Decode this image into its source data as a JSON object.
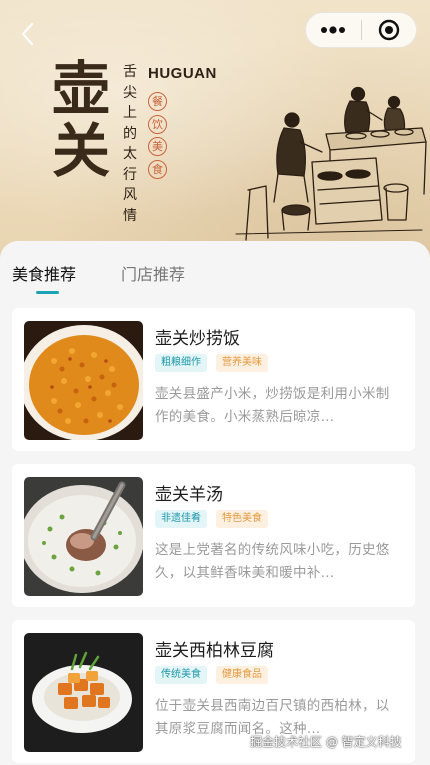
{
  "header": {
    "brand_chars": [
      "壶",
      "关"
    ],
    "brand_en": "HUGUAN",
    "slogan_chars": [
      "舌",
      "尖",
      "上",
      "的",
      "太",
      "行",
      "风",
      "情"
    ],
    "seal_chars": [
      "餐",
      "饮",
      "美",
      "食"
    ]
  },
  "nav": {
    "back_icon": "chevron-left-icon",
    "more_icon": "more-dots-icon",
    "close_icon": "target-circle-icon"
  },
  "tabs": [
    {
      "label": "美食推荐",
      "active": true
    },
    {
      "label": "门店推荐",
      "active": false
    }
  ],
  "foods": [
    {
      "title": "壶关炒捞饭",
      "tags": [
        "粗粮细作",
        "营养美味"
      ],
      "desc": "壶关县盛产小米，炒捞饭是利用小米制作的美食。小米蒸熟后晾凉…"
    },
    {
      "title": "壶关羊汤",
      "tags": [
        "非遗佳肴",
        "特色美食"
      ],
      "desc": "这是上党著名的传统风味小吃，历史悠久，以其鲜香味美和暖中补…"
    },
    {
      "title": "壶关西柏林豆腐",
      "tags": [
        "传统美食",
        "健康食品"
      ],
      "desc": "位于壶关县西南边百尺镇的西柏林，以其原浆豆腐而闻名。这种…"
    }
  ],
  "watermark": "掘金技术社区 @ 智定义科技",
  "colors": {
    "accent": "#1aa3b5",
    "tag_teal_bg": "#e4f5f7",
    "tag_teal_text": "#1e98a9",
    "tag_orange_bg": "#fdf0e0",
    "tag_orange_text": "#e39a3e",
    "seal": "#c9633a"
  }
}
